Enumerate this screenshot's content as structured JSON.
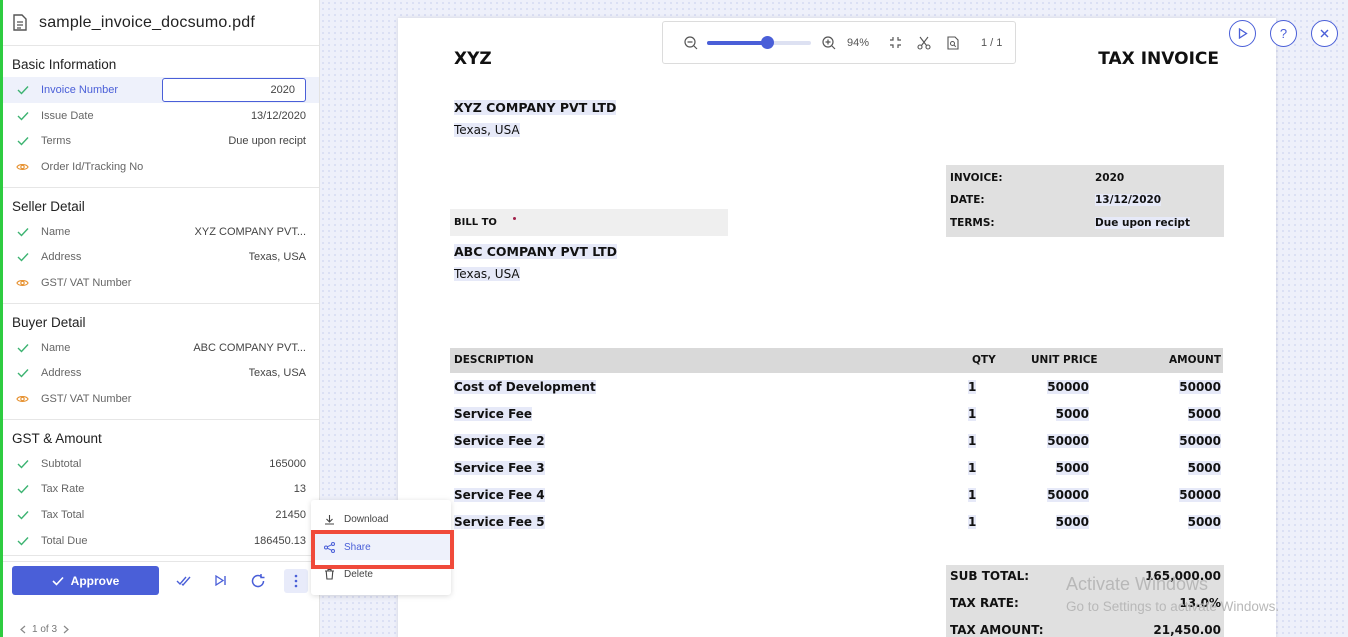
{
  "sidebar": {
    "file_name": "sample_invoice_docsumo.pdf",
    "sections": [
      {
        "title": "Basic Information",
        "fields": [
          {
            "label": "Invoice Number",
            "value": "2020",
            "status": "check",
            "active": true
          },
          {
            "label": "Issue Date",
            "value": "13/12/2020",
            "status": "check"
          },
          {
            "label": "Terms",
            "value": "Due upon recipt",
            "status": "check"
          },
          {
            "label": "Order Id/Tracking No",
            "value": "",
            "status": "eye"
          }
        ]
      },
      {
        "title": "Seller Detail",
        "fields": [
          {
            "label": "Name",
            "value": "XYZ COMPANY PVT...",
            "status": "check"
          },
          {
            "label": "Address",
            "value": "Texas, USA",
            "status": "check"
          },
          {
            "label": "GST/ VAT Number",
            "value": "",
            "status": "eye"
          }
        ]
      },
      {
        "title": "Buyer Detail",
        "fields": [
          {
            "label": "Name",
            "value": "ABC COMPANY PVT...",
            "status": "check"
          },
          {
            "label": "Address",
            "value": "Texas, USA",
            "status": "check"
          },
          {
            "label": "GST/ VAT Number",
            "value": "",
            "status": "eye"
          }
        ]
      },
      {
        "title": "GST & Amount",
        "fields": [
          {
            "label": "Subtotal",
            "value": "165000",
            "status": "check"
          },
          {
            "label": "Tax Rate",
            "value": "13",
            "status": "check"
          },
          {
            "label": "Tax Total",
            "value": "21450",
            "status": "check"
          },
          {
            "label": "Total Due",
            "value": "186450.13",
            "status": "check"
          }
        ]
      }
    ],
    "approve_label": "Approve",
    "pager": "1 of 3"
  },
  "menu": {
    "download": "Download",
    "share": "Share",
    "delete": "Delete"
  },
  "toolbar": {
    "zoom": "94%",
    "zoom_fraction": 0.58,
    "page_indicator": "1 / 1"
  },
  "invoice": {
    "company": "XYZ",
    "doc_title": "TAX INVOICE",
    "seller_name": "XYZ COMPANY PVT LTD",
    "seller_address": "Texas, USA",
    "meta": [
      {
        "label": "INVOICE:",
        "value": "2020"
      },
      {
        "label": "DATE:",
        "value": "13/12/2020"
      },
      {
        "label": "TERMS:",
        "value": "Due upon recipt"
      }
    ],
    "bill_to_label": "BILL TO",
    "buyer_name": "ABC COMPANY PVT LTD",
    "buyer_address": "Texas, USA",
    "columns": [
      "DESCRIPTION",
      "QTY",
      "UNIT PRICE",
      "AMOUNT"
    ],
    "rows": [
      {
        "desc": "Cost of Development",
        "qty": "1",
        "price": "50000",
        "amount": "50000"
      },
      {
        "desc": "Service Fee",
        "qty": "1",
        "price": "5000",
        "amount": "5000"
      },
      {
        "desc": "Service Fee 2",
        "qty": "1",
        "price": "50000",
        "amount": "50000"
      },
      {
        "desc": "Service Fee 3",
        "qty": "1",
        "price": "5000",
        "amount": "5000"
      },
      {
        "desc": "Service Fee 4",
        "qty": "1",
        "price": "50000",
        "amount": "50000"
      },
      {
        "desc": "Service Fee 5",
        "qty": "1",
        "price": "5000",
        "amount": "5000"
      }
    ],
    "totals": [
      {
        "label": "SUB TOTAL:",
        "value": "165,000.00"
      },
      {
        "label": "TAX RATE:",
        "value": "13.0%"
      },
      {
        "label": "TAX AMOUNT:",
        "value": "21,450.00"
      }
    ]
  },
  "watermark": {
    "line1": "Activate Windows",
    "line2": "Go to Settings to activate Windows."
  },
  "colors": {
    "accent": "#4a5fd8",
    "check": "#3cb371",
    "eye": "#e6902e",
    "highlight": "#f04a3a"
  }
}
